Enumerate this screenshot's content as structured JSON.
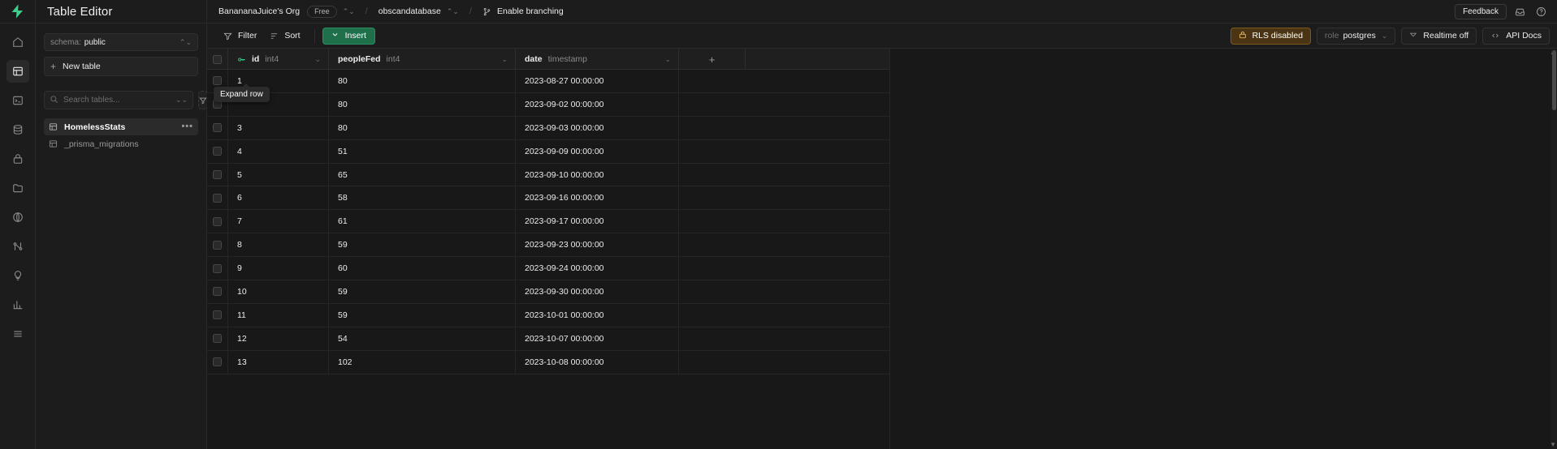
{
  "rail": {
    "logo": "supabase-logo",
    "items": [
      {
        "name": "home-icon",
        "active": false
      },
      {
        "name": "table-editor-icon",
        "active": true
      },
      {
        "name": "sql-editor-icon",
        "active": false
      },
      {
        "name": "database-icon",
        "active": false
      },
      {
        "name": "auth-lock-icon",
        "active": false
      },
      {
        "name": "storage-icon",
        "active": false
      },
      {
        "name": "edge-functions-icon",
        "active": false
      },
      {
        "name": "realtime-icon",
        "active": false
      },
      {
        "name": "advisors-icon",
        "active": false
      },
      {
        "name": "reports-icon",
        "active": false
      },
      {
        "name": "logs-icon",
        "active": false
      }
    ]
  },
  "panel": {
    "title": "Table Editor",
    "schema": {
      "label": "schema:",
      "value": "public"
    },
    "new_table": "New table",
    "search": {
      "placeholder": "Search tables...",
      "value": ""
    },
    "tables": [
      {
        "name": "HomelessStats",
        "selected": true
      },
      {
        "name": "_prisma_migrations",
        "selected": false
      }
    ]
  },
  "topbar": {
    "org": "BanananaJuice's Org",
    "plan": "Free",
    "database": "obscandatabase",
    "branching": "Enable branching",
    "feedback": "Feedback",
    "separator": "/"
  },
  "toolbar": {
    "filter": "Filter",
    "sort": "Sort",
    "insert": "Insert",
    "rls": "RLS disabled",
    "role_key": "role",
    "role_value": "postgres",
    "realtime": "Realtime off",
    "api_docs": "API Docs"
  },
  "tooltip": {
    "text": "Expand row"
  },
  "grid": {
    "columns": [
      {
        "name": "id",
        "type": "int4",
        "primary_key": true
      },
      {
        "name": "peopleFed",
        "type": "int4",
        "primary_key": false
      },
      {
        "name": "date",
        "type": "timestamp",
        "primary_key": false
      }
    ],
    "rows": [
      {
        "id": "1",
        "peopleFed": "80",
        "date": "2023-08-27 00:00:00"
      },
      {
        "id": "",
        "peopleFed": "80",
        "date": "2023-09-02 00:00:00"
      },
      {
        "id": "3",
        "peopleFed": "80",
        "date": "2023-09-03 00:00:00"
      },
      {
        "id": "4",
        "peopleFed": "51",
        "date": "2023-09-09 00:00:00"
      },
      {
        "id": "5",
        "peopleFed": "65",
        "date": "2023-09-10 00:00:00"
      },
      {
        "id": "6",
        "peopleFed": "58",
        "date": "2023-09-16 00:00:00"
      },
      {
        "id": "7",
        "peopleFed": "61",
        "date": "2023-09-17 00:00:00"
      },
      {
        "id": "8",
        "peopleFed": "59",
        "date": "2023-09-23 00:00:00"
      },
      {
        "id": "9",
        "peopleFed": "60",
        "date": "2023-09-24 00:00:00"
      },
      {
        "id": "10",
        "peopleFed": "59",
        "date": "2023-09-30 00:00:00"
      },
      {
        "id": "11",
        "peopleFed": "59",
        "date": "2023-10-01 00:00:00"
      },
      {
        "id": "12",
        "peopleFed": "54",
        "date": "2023-10-07 00:00:00"
      },
      {
        "id": "13",
        "peopleFed": "102",
        "date": "2023-10-08 00:00:00"
      }
    ]
  },
  "colors": {
    "brand_green": "#3ecf8e",
    "insert_green": "#1f6f4a",
    "rls_amber": "#f5c96b",
    "background": "#1c1c1c",
    "grid_background": "#181818"
  }
}
